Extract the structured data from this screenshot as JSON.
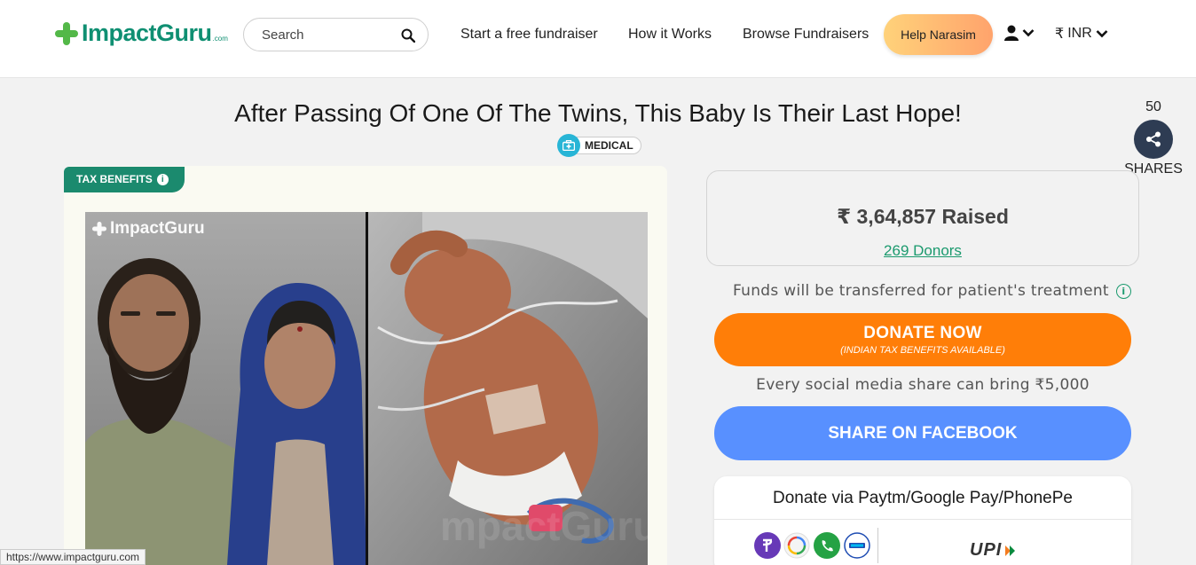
{
  "header": {
    "logo_text": "ImpactGuru",
    "logo_suffix": ".com",
    "search_placeholder": "Search",
    "nav": [
      "Start a free fundraiser",
      "How it Works",
      "Browse Fundraisers"
    ],
    "help_button": "Help Narasim",
    "currency_symbol": "₹",
    "currency_label": "INR"
  },
  "campaign": {
    "title": "After Passing Of One Of The Twins, This Baby Is Their Last Hope!",
    "category": "MEDICAL",
    "tax_badge": "TAX BENEFITS",
    "photo_watermark": "ImpactGuru"
  },
  "share": {
    "count": "50",
    "label": "SHARES"
  },
  "funding": {
    "raised": "₹ 3,64,857 Raised",
    "donors": "269 Donors",
    "funds_note": "Funds will be transferred for patient's treatment",
    "donate_label": "DONATE NOW",
    "donate_sub": "(INDIAN TAX BENEFITS AVAILABLE)",
    "social_note": "Every social media share can bring ₹5,000",
    "facebook_label": "SHARE ON FACEBOOK",
    "upi_title": "Donate via Paytm/Google Pay/PhonePe",
    "upi_logo": "UPI"
  },
  "status_bar": {
    "url": "https://www.impactguru.com"
  },
  "colors": {
    "brand_green": "#0f8f72",
    "donate_orange": "#ff7e08",
    "facebook_blue": "#5890ff",
    "share_dark": "#2e3c53"
  }
}
